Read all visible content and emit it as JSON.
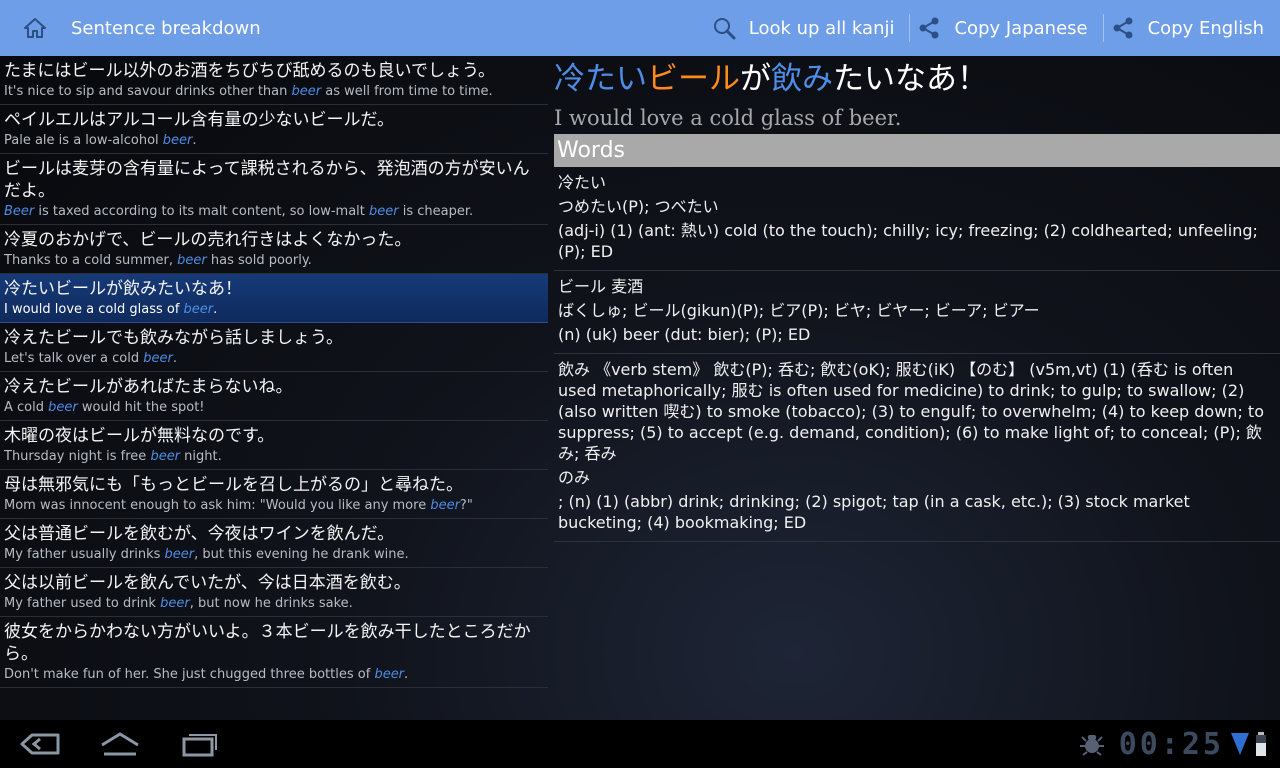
{
  "actionbar": {
    "title": "Sentence breakdown",
    "actions": [
      {
        "label": "Look up all kanji",
        "icon": "magnifier-icon"
      },
      {
        "label": "Copy Japanese",
        "icon": "share-icon"
      },
      {
        "label": "Copy English",
        "icon": "share-icon"
      }
    ],
    "background": "#6f9ee8"
  },
  "sentences": [
    {
      "jp": "たまにはビール以外のお酒をちびちび舐めるのも良いでしょう。",
      "en_before": "It's nice to sip and savour drinks other than ",
      "en_hl": "beer",
      "en_after": " as well from time to time."
    },
    {
      "jp": "ペイルエルはアルコール含有量の少ないビールだ。",
      "en_before": "Pale ale is a low-alcohol ",
      "en_hl": "beer",
      "en_after": "."
    },
    {
      "jp": "ビールは麦芽の含有量によって課税されるから、発泡酒の方が安いんだよ。",
      "en_before": "",
      "en_hl": "Beer",
      "en_after": " is taxed according to its malt content, so low-malt ",
      "en_hl2": "beer",
      "en_after2": " is cheaper."
    },
    {
      "jp": "冷夏のおかげで、ビールの売れ行きはよくなかった。",
      "en_before": "Thanks to a cold summer, ",
      "en_hl": "beer",
      "en_after": " has sold poorly."
    },
    {
      "jp": "冷たいビールが飲みたいなあ！",
      "en_before": "I would love a cold glass of ",
      "en_hl": "beer",
      "en_after": ".",
      "selected": true
    },
    {
      "jp": "冷えたビールでも飲みながら話しましょう。",
      "en_before": "Let's talk over a cold ",
      "en_hl": "beer",
      "en_after": "."
    },
    {
      "jp": "冷えたビールがあればたまらないね。",
      "en_before": "A cold ",
      "en_hl": "beer",
      "en_after": " would hit the spot!"
    },
    {
      "jp": "木曜の夜はビールが無料なのです。",
      "en_before": "Thursday night is free ",
      "en_hl": "beer",
      "en_after": " night."
    },
    {
      "jp": "母は無邪気にも「もっとビールを召し上がるの」と尋ねた。",
      "en_before": "Mom was innocent enough to ask him: \"Would you like any more ",
      "en_hl": "beer",
      "en_after": "?\""
    },
    {
      "jp": "父は普通ビールを飲むが、今夜はワインを飲んだ。",
      "en_before": "My father usually drinks ",
      "en_hl": "beer",
      "en_after": ", but this evening he drank wine."
    },
    {
      "jp": "父は以前ビールを飲んでいたが、今は日本酒を飲む。",
      "en_before": "My father used to drink ",
      "en_hl": "beer",
      "en_after": ", but now he drinks sake."
    },
    {
      "jp": "彼女をからかわない方がいいよ。３本ビールを飲み干したところだから。",
      "en_before": "Don't make fun of her. She just chugged three bottles of ",
      "en_hl": "beer",
      "en_after": "."
    }
  ],
  "detail": {
    "sentence_segments": [
      {
        "text": "冷たい",
        "color": "#4d8de6"
      },
      {
        "text": "ビール",
        "color": "#ff8a1c"
      },
      {
        "text": "が",
        "color": "#ffffff"
      },
      {
        "text": "飲み",
        "color": "#4d8de6"
      },
      {
        "text": "たいなあ！",
        "color": "#ffffff"
      }
    ],
    "translation": "I would love a cold glass of beer.",
    "words_header": "Words",
    "entries": [
      {
        "lines": [
          "冷たい",
          "つめたい(P); つべたい",
          "(adj-i) (1) (ant: 熱い) cold (to the touch); chilly; icy; freezing; (2) coldhearted; unfeeling; (P); ED"
        ]
      },
      {
        "lines": [
          "ビール 麦酒",
          "ばくしゅ; ビール(gikun)(P); ビア(P); ビヤ; ビヤー; ビーア; ビアー",
          "(n) (uk) beer (dut: bier); (P); ED"
        ]
      },
      {
        "lines": [
          "飲み 《verb stem》 飲む(P); 呑む; 飮む(oK); 服む(iK) 【のむ】 (v5m,vt) (1) (呑む is often used metaphorically;  服む is often used for medicine) to drink; to gulp; to swallow; (2) (also written 喫む) to smoke (tobacco); (3) to engulf; to overwhelm; (4) to keep down; to suppress; (5) to accept (e.g. demand, condition); (6) to make light of; to conceal; (P);  飲み; 呑み",
          "のみ",
          "; (n) (1) (abbr) drink; drinking; (2) spigot; tap (in a cask, etc.); (3) stock market bucketing; (4) bookmaking; ED"
        ]
      }
    ]
  },
  "sysbar": {
    "clock": "00:25",
    "nav": [
      {
        "icon": "back-icon"
      },
      {
        "icon": "home-icon"
      },
      {
        "icon": "recent-apps-icon"
      }
    ],
    "status_icons": [
      "usb-debug-icon",
      "wifi-signal-icon",
      "battery-icon"
    ]
  }
}
